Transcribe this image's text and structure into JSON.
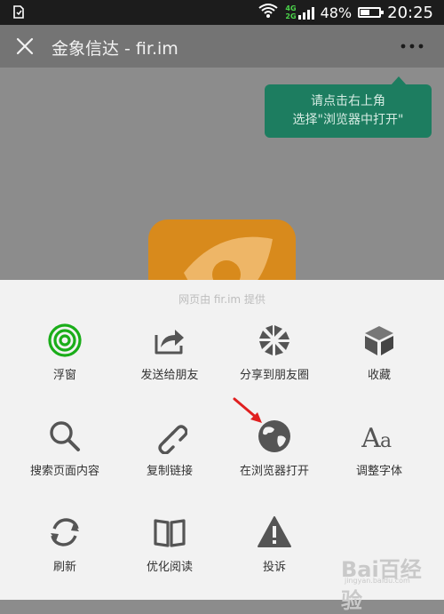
{
  "status": {
    "network_top": "4G",
    "network_bottom": "2G",
    "battery_percent_text": "48%",
    "battery_level": 0.48,
    "time": "20:25"
  },
  "titlebar": {
    "title": "金象信达 - fir.im",
    "close_icon": "close-icon",
    "more_icon": "more-dots-icon"
  },
  "tooltip": {
    "line1": "请点击右上角",
    "line2": "选择\"浏览器中打开\""
  },
  "sheet": {
    "provider_text": "网页由 fir.im 提供",
    "actions": [
      {
        "label": "浮窗",
        "icon": "float-window-icon",
        "color": "#1aad19"
      },
      {
        "label": "发送给朋友",
        "icon": "share-arrow-icon",
        "color": "#555555"
      },
      {
        "label": "分享到朋友圈",
        "icon": "moments-aperture-icon",
        "color": "#555555"
      },
      {
        "label": "收藏",
        "icon": "favorite-cube-icon",
        "color": "#555555"
      },
      {
        "label": "搜索页面内容",
        "icon": "search-icon",
        "color": "#555555"
      },
      {
        "label": "复制链接",
        "icon": "link-icon",
        "color": "#555555"
      },
      {
        "label": "在浏览器打开",
        "icon": "globe-icon",
        "color": "#555555"
      },
      {
        "label": "调整字体",
        "icon": "font-aa-icon",
        "color": "#555555"
      },
      {
        "label": "刷新",
        "icon": "refresh-icon",
        "color": "#555555"
      },
      {
        "label": "优化阅读",
        "icon": "book-icon",
        "color": "#555555"
      },
      {
        "label": "投诉",
        "icon": "warning-icon",
        "color": "#555555"
      }
    ]
  },
  "colors": {
    "accent_green": "#1aad19",
    "tooltip_bg": "#1d7d60",
    "arrow_red": "#e02020"
  },
  "watermark": {
    "main": "Bai百经验",
    "sub": "jingyan.baidu.com"
  }
}
